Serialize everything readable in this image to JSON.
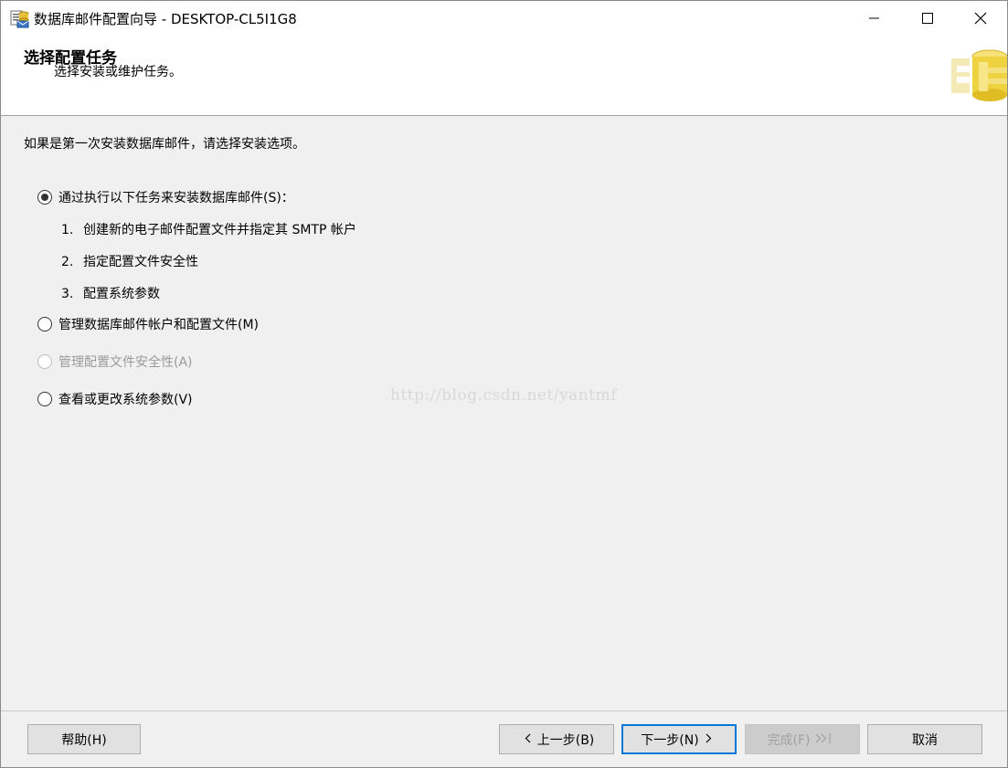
{
  "window": {
    "title": "数据库邮件配置向导 - DESKTOP-CL5I1G8",
    "icon": "database-mail-wizard-icon"
  },
  "header": {
    "title": "选择配置任务",
    "subtitle": "选择安装或维护任务。",
    "logo": "database-mail-logo-icon"
  },
  "content": {
    "intro": "如果是第一次安装数据库邮件，请选择安装选项。",
    "options": [
      {
        "label": "通过执行以下任务来安装数据库邮件(S)：",
        "selected": true,
        "enabled": true
      },
      {
        "label": "管理数据库邮件帐户和配置文件(M)",
        "selected": false,
        "enabled": true
      },
      {
        "label": "管理配置文件安全性(A)",
        "selected": false,
        "enabled": false
      },
      {
        "label": "查看或更改系统参数(V)",
        "selected": false,
        "enabled": true
      }
    ],
    "steps": [
      {
        "num": "1.",
        "text": "创建新的电子邮件配置文件并指定其 SMTP 帐户"
      },
      {
        "num": "2.",
        "text": "指定配置文件安全性"
      },
      {
        "num": "3.",
        "text": "配置系统参数"
      }
    ],
    "watermark": "http://blog.csdn.net/yantmf"
  },
  "footer": {
    "help": "帮助(H)",
    "back": "上一步(B)",
    "next": "下一步(N)",
    "finish": "完成(F)",
    "cancel": "取消"
  },
  "colors": {
    "focus_border": "#0078d7",
    "panel_bg": "#f0f0f0",
    "logo_yellow": "#f0d030"
  }
}
